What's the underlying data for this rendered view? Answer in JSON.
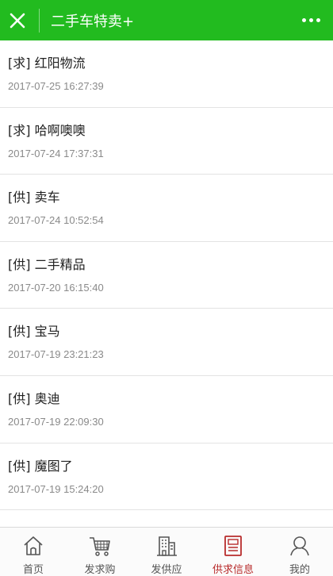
{
  "header": {
    "title": "二手车特卖+",
    "close_icon": "close-icon",
    "more_icon": "more-dots-icon",
    "bg_color": "#22bb1f"
  },
  "list": {
    "items": [
      {
        "title": "[求] 红阳物流",
        "time": "2017-07-25 16:27:39"
      },
      {
        "title": "[求] 哈啊噢噢",
        "time": "2017-07-24 17:37:31"
      },
      {
        "title": "[供] 卖车",
        "time": "2017-07-24 10:52:54"
      },
      {
        "title": "[供] 二手精品",
        "time": "2017-07-20 16:15:40"
      },
      {
        "title": "[供] 宝马",
        "time": "2017-07-19 23:21:23"
      },
      {
        "title": "[供] 奥迪",
        "time": "2017-07-19 22:09:30"
      },
      {
        "title": "[供] 魔图了",
        "time": "2017-07-19 15:24:20"
      }
    ]
  },
  "tabbar": {
    "active_color": "#b82c2c",
    "tabs": [
      {
        "label": "首页",
        "icon": "home-icon"
      },
      {
        "label": "发求购",
        "icon": "cart-icon"
      },
      {
        "label": "发供应",
        "icon": "building-icon"
      },
      {
        "label": "供求信息",
        "icon": "news-icon",
        "active": true
      },
      {
        "label": "我的",
        "icon": "user-icon"
      }
    ]
  }
}
